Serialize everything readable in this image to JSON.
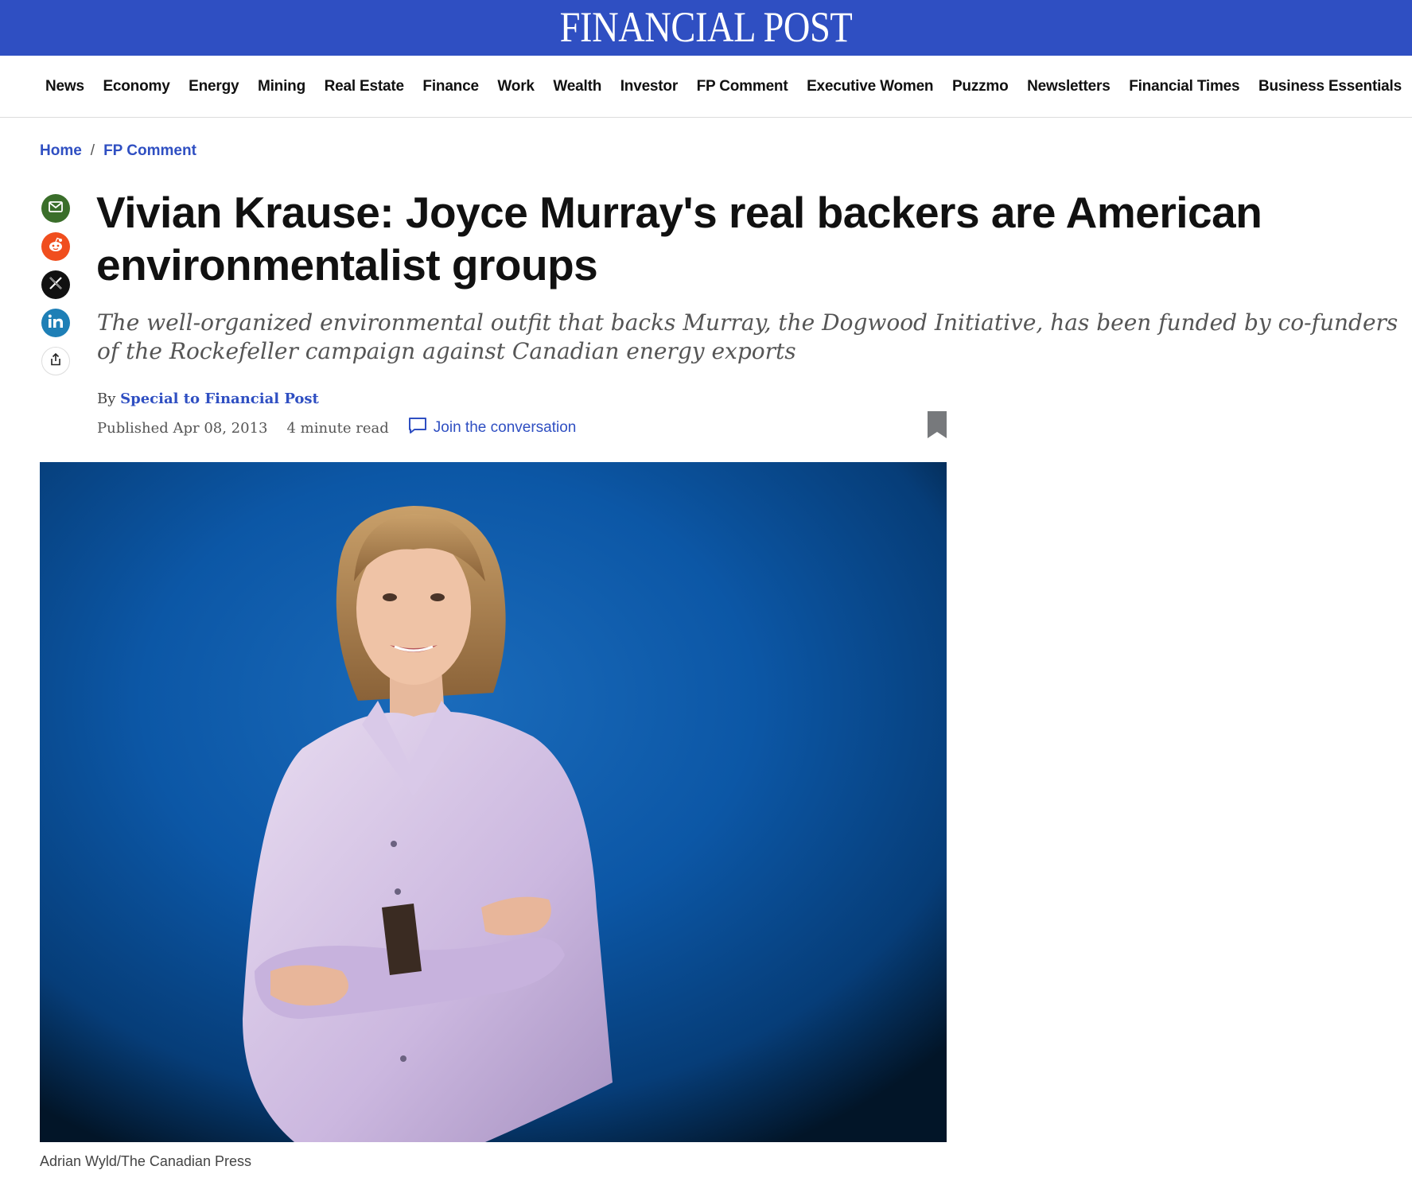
{
  "masthead": {
    "logo": "FINANCIAL POST"
  },
  "nav": {
    "items": [
      "News",
      "Economy",
      "Energy",
      "Mining",
      "Real Estate",
      "Finance",
      "Work",
      "Wealth",
      "Investor",
      "FP Comment",
      "Executive Women",
      "Puzzmo",
      "Newsletters",
      "Financial Times",
      "Business Essentials"
    ]
  },
  "breadcrumb": {
    "home": "Home",
    "separator": "/",
    "section": "FP Comment"
  },
  "article": {
    "headline": "Vivian Krause: Joyce Murray's real backers are American environmentalist groups",
    "dek": "The well-organized environmental outfit that backs Murray, the Dogwood Initiative, has been funded by co-funders of the Rockefeller campaign against Canadian energy exports",
    "byline_prefix": "By",
    "author": "Special to Financial Post",
    "published": "Published Apr 08, 2013",
    "read_time": "4 minute read",
    "join_conversation": "Join the conversation",
    "photo_credit": "Adrian Wyld/The Canadian Press"
  },
  "share_icons": [
    "email-icon",
    "reddit-icon",
    "x-icon",
    "linkedin-icon",
    "share-icon"
  ],
  "colors": {
    "brand": "#2f4fc2",
    "email": "#3a6e2a",
    "reddit": "#f04e1e",
    "x": "#111111",
    "linkedin": "#1e7fb6"
  }
}
